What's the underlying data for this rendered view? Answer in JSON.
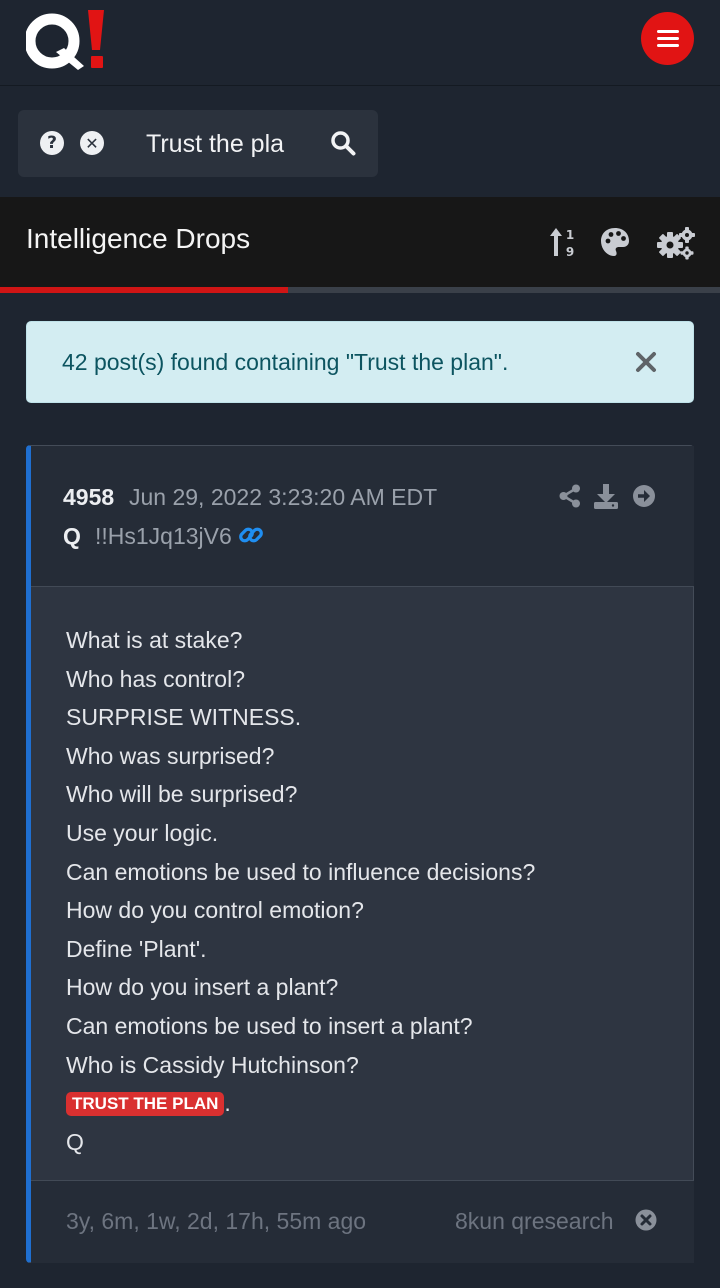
{
  "header": {
    "logo_text": "Q!",
    "menu_icon": "hamburger-menu-icon"
  },
  "search": {
    "value": "Trust the pla",
    "help_icon": "question-circle-icon",
    "clear_icon": "times-circle-icon",
    "search_icon": "search-icon"
  },
  "section": {
    "title": "Intelligence Drops",
    "tools": [
      "sort-numeric-icon",
      "palette-icon",
      "cogs-icon"
    ],
    "progress": 0.4
  },
  "alert": {
    "text": "42 post(s) found containing \"Trust the plan\"."
  },
  "post": {
    "number": "4958",
    "date": "Jun 29, 2022 3:23:20 AM EDT",
    "author": "Q",
    "tripcode": "!!Hs1Jq13jV6",
    "lines": [
      "What is at stake?",
      "Who has control?",
      "SURPRISE WITNESS.",
      "Who was surprised?",
      "Who will be surprised?",
      "Use your logic.",
      "Can emotions be used to influence decisions?",
      "How do you control emotion?",
      "Define 'Plant'.",
      "How do you insert a plant?",
      "Can emotions be used to insert a plant?",
      "Who is Cassidy Hutchinson?"
    ],
    "highlight": "TRUST THE PLAN",
    "highlight_suffix": ".",
    "signature": "Q",
    "age": "3y, 6m, 1w, 2d, 17h, 55m ago",
    "source": "8kun qresearch"
  },
  "colors": {
    "accent_red": "#e11414",
    "post_border": "#1f6fd0",
    "alert_bg": "#d3edf2",
    "alert_text": "#0c5460"
  }
}
